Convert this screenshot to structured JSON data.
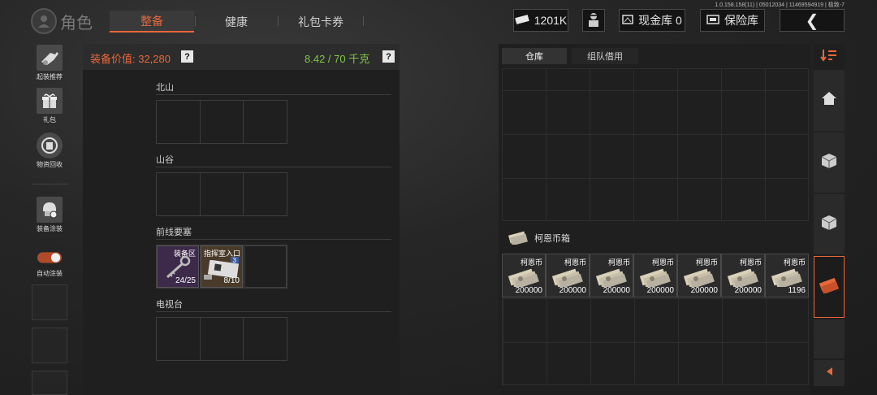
{
  "version": "1.0.158.158(11) | 05012034 | 11469594919 | 极致-7",
  "header": {
    "title": "角色",
    "tabs": [
      {
        "label": "整备",
        "active": true
      },
      {
        "label": "健康",
        "active": false
      },
      {
        "label": "礼包卡券",
        "active": false
      }
    ],
    "currency": "1201K",
    "cash_vault": "现金库 0",
    "safe": "保险库",
    "back": "❮"
  },
  "sidebar": {
    "items": [
      {
        "label": "起装推荐",
        "icon": "gun-icon"
      },
      {
        "label": "礼包",
        "icon": "gift-icon"
      },
      {
        "label": "物资回收",
        "icon": "recycle-icon"
      },
      {
        "label": "装备涂装",
        "icon": "helmet-icon"
      },
      {
        "label": "自动涂装",
        "icon": "toggle-icon"
      }
    ]
  },
  "loadout": {
    "value_label": "装备价值: 32,280",
    "weight": "8.42 / 70 千克",
    "help": "?",
    "sections": [
      {
        "label": "北山"
      },
      {
        "label": "山谷"
      },
      {
        "label": "前线要塞"
      },
      {
        "label": "电视台"
      }
    ],
    "items": [
      {
        "name": "装备区",
        "count": "24/25",
        "bg": "#3d2a4a"
      },
      {
        "name": "指挥室入口",
        "count": "8/10",
        "badge": "3",
        "bg": "#4a3a2a"
      }
    ]
  },
  "stash": {
    "tabs": [
      {
        "label": "仓库",
        "active": true
      },
      {
        "label": "组队借用",
        "active": false
      }
    ],
    "money_box": {
      "label": "柯恩币箱",
      "cells": [
        {
          "name": "柯恩币",
          "count": "200000"
        },
        {
          "name": "柯恩币",
          "count": "200000"
        },
        {
          "name": "柯恩币",
          "count": "200000"
        },
        {
          "name": "柯恩币",
          "count": "200000"
        },
        {
          "name": "柯恩币",
          "count": "200000"
        },
        {
          "name": "柯恩币",
          "count": "200000"
        },
        {
          "name": "柯恩币",
          "count": "1196"
        }
      ]
    }
  },
  "colors": {
    "accent": "#e8683a",
    "weight_green": "#7ec84a",
    "value_orange": "#e8683a"
  }
}
